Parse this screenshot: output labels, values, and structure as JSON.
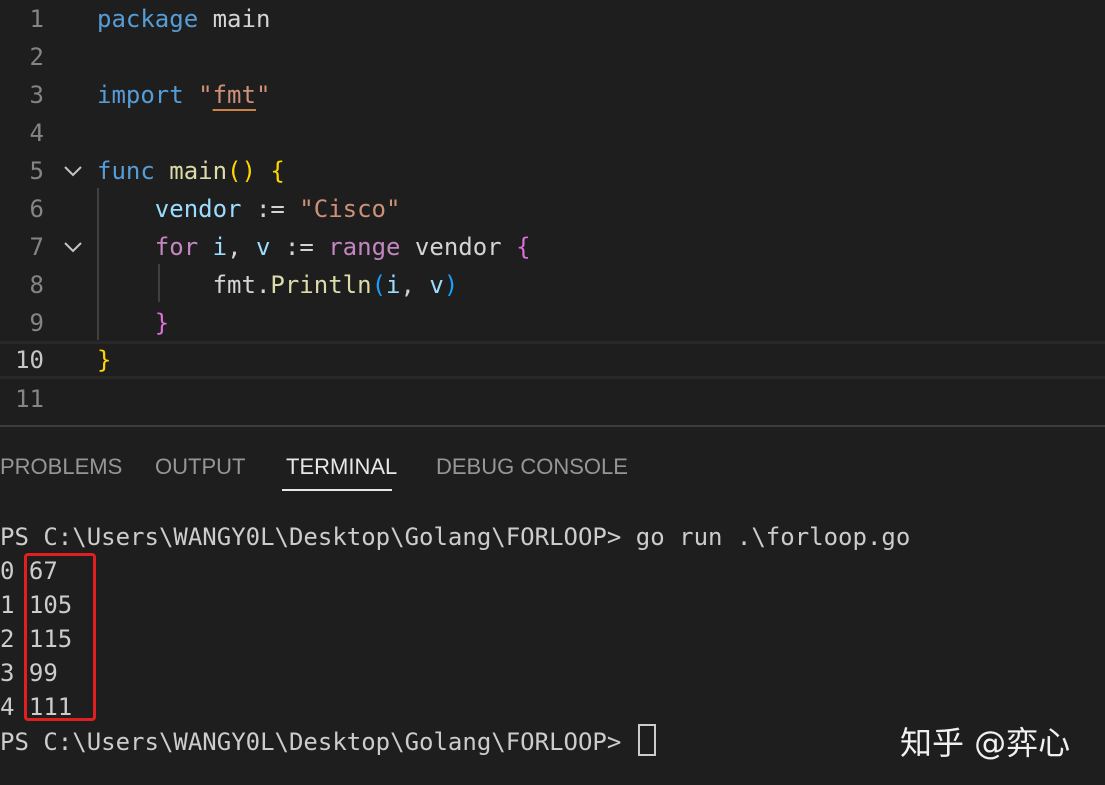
{
  "editor": {
    "line_numbers": [
      "1",
      "2",
      "3",
      "4",
      "5",
      "6",
      "7",
      "8",
      "9",
      "10",
      "11"
    ],
    "tokens": {
      "l1_kw": "package",
      "l1_name": " main",
      "l3_kw": "import",
      "l3_str_open": " \"",
      "l3_str_body": "fmt",
      "l3_str_close": "\"",
      "l5_kw": "func",
      "l5_fn": " main",
      "l5_parens": "()",
      "l5_brace": " {",
      "l6_var": "    vendor",
      "l6_op": " := ",
      "l6_str": "\"Cisco\"",
      "l7_kw": "    for",
      "l7_i": " i",
      "l7_comma": ",",
      "l7_v": " v",
      "l7_op": " := ",
      "l7_range": "range",
      "l7_vendor": " vendor",
      "l7_brace": " {",
      "l8_pkg": "        fmt",
      "l8_dot": ".",
      "l8_fn": "Println",
      "l8_open": "(",
      "l8_i": "i",
      "l8_comma": ", ",
      "l8_v": "v",
      "l8_close": ")",
      "l9_brace": "    }",
      "l10_brace": "}"
    }
  },
  "panel": {
    "tabs": [
      {
        "label": "PROBLEMS"
      },
      {
        "label": "OUTPUT"
      },
      {
        "label": "TERMINAL"
      },
      {
        "label": "DEBUG CONSOLE"
      }
    ],
    "active_tab": "TERMINAL"
  },
  "terminal": {
    "command_line": "PS C:\\Users\\WANGY0L\\Desktop\\Golang\\FORLOOP> go run .\\forloop.go",
    "output": [
      {
        "index": "0",
        "value": "67"
      },
      {
        "index": "1",
        "value": "105"
      },
      {
        "index": "2",
        "value": "115"
      },
      {
        "index": "3",
        "value": "99"
      },
      {
        "index": "4",
        "value": "111"
      }
    ],
    "prompt": "PS C:\\Users\\WANGY0L\\Desktop\\Golang\\FORLOOP> "
  },
  "watermark": "知乎 @弈心",
  "colors": {
    "background": "#1e1e1e",
    "keyword": "#569cd6",
    "control_keyword": "#c586c0",
    "function": "#dcdcaa",
    "string": "#ce9178",
    "variable": "#9cdcfe",
    "highlight_box": "#e02020"
  }
}
